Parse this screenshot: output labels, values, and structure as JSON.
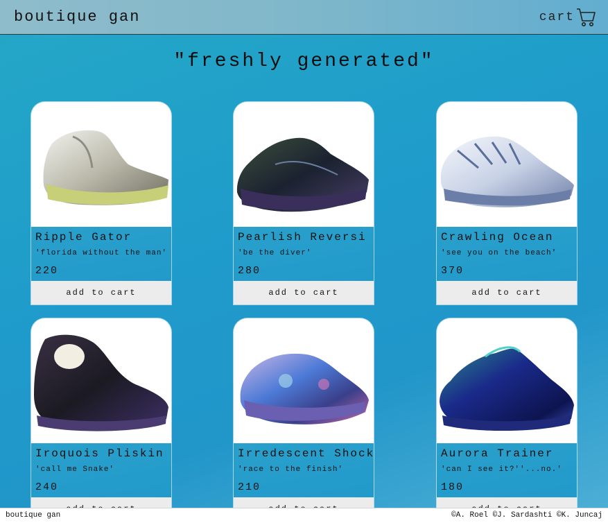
{
  "header": {
    "brand": "boutique gan",
    "cart_label": "cart",
    "cart_icon": "shopping-cart-icon"
  },
  "page_title": "\"freshly generated\"",
  "products": [
    {
      "name": "Ripple Gator",
      "tagline": "'florida without the man'",
      "price": "220",
      "button": "add to cart",
      "image_icon": "sneaker-image"
    },
    {
      "name": "Pearlish Reversi",
      "tagline": "'be the diver'",
      "price": "280",
      "button": "add to cart",
      "image_icon": "sneaker-image"
    },
    {
      "name": "Crawling Ocean",
      "tagline": "'see you on the beach'",
      "price": "370",
      "button": "add to cart",
      "image_icon": "sneaker-image"
    },
    {
      "name": "Iroquois Pliskin",
      "tagline": "'call me Snake'",
      "price": "240",
      "button": "add to cart",
      "image_icon": "sneaker-image"
    },
    {
      "name": "Irredescent Shock",
      "tagline": "'race to the finish'",
      "price": "210",
      "button": "add to cart",
      "image_icon": "sneaker-image"
    },
    {
      "name": "Aurora Trainer",
      "tagline": "'can I see it?''...no.'",
      "price": "180",
      "button": "add to cart",
      "image_icon": "sneaker-image"
    }
  ],
  "footer": {
    "left": "boutique gan",
    "right": "©A. Roel ©J. Sardashti ©K. Juncaj"
  }
}
